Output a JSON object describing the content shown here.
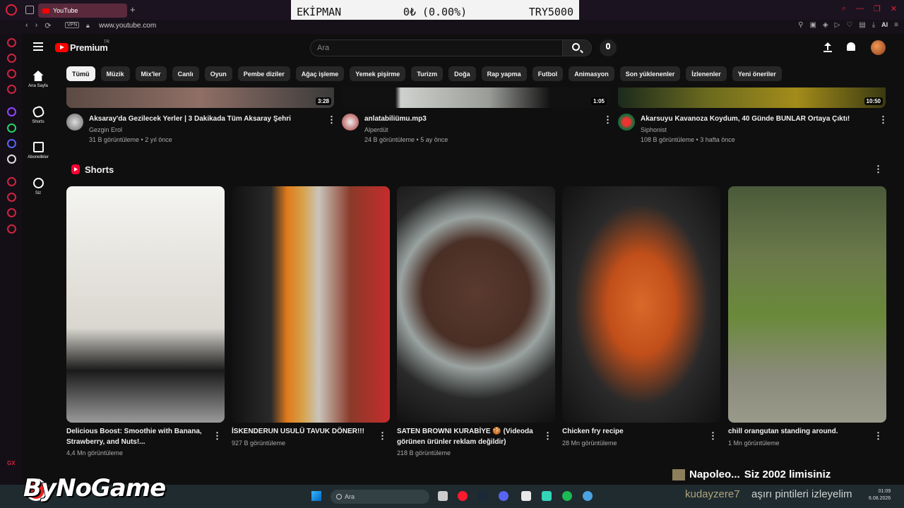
{
  "browser": {
    "tab_title": "YouTube",
    "tab_add": "+",
    "url": "www.youtube.com",
    "vpn_label": "VPN",
    "ai_label": "AI",
    "nav": [
      "‹",
      "›",
      "⟳"
    ],
    "window_controls": [
      "⌕",
      "—",
      "❐",
      "✕"
    ],
    "gx_label": "GX"
  },
  "overlay_stats": {
    "name": "EKİPMAN",
    "value": "0₺ (0.00%)",
    "total": "TRY5000"
  },
  "youtube": {
    "brand": "Premium",
    "region": "TR",
    "search_placeholder": "Ara",
    "left_nav": [
      {
        "label": "Ana Sayfa",
        "icon": "home-icon"
      },
      {
        "label": "Shorts",
        "icon": "shorts-icon"
      },
      {
        "label": "Abonelikler",
        "icon": "subscriptions-icon"
      },
      {
        "label": "Siz",
        "icon": "you-icon"
      }
    ],
    "chips": [
      "Tümü",
      "Müzik",
      "Mix'ler",
      "Canlı",
      "Oyun",
      "Pembe diziler",
      "Ağaç işleme",
      "Yemek pişirme",
      "Turizm",
      "Doğa",
      "Rap yapma",
      "Futbol",
      "Animasyon",
      "Son yüklenenler",
      "İzlenenler",
      "Yeni öneriler"
    ],
    "active_chip": "Tümü",
    "videos": [
      {
        "title": "Aksaray'da Gezilecek Yerler | 3 Dakikada Tüm Aksaray Şehri",
        "channel": "Gezgin Erol",
        "meta": "31 B görüntüleme • 2 yıl önce",
        "duration": "3:28"
      },
      {
        "title": "anlatabiliümu.mp3",
        "channel": "Alperdüt",
        "meta": "24 B görüntüleme • 5 ay önce",
        "duration": "1:05"
      },
      {
        "title": "Akarsuyu Kavanoza Koydum, 40 Günde BUNLAR Ortaya Çıktı!",
        "channel": "Siphonist",
        "meta": "108 B görüntüleme • 3 hafta önce",
        "duration": "10:50"
      }
    ],
    "shorts_heading": "Shorts",
    "shorts": [
      {
        "title": "Delicious Boost: Smoothie with Banana, Strawberry, and Nuts!...",
        "views": "4,4 Mn görüntüleme"
      },
      {
        "title": "İSKENDERUN USULÜ TAVUK DÖNER!!!",
        "views": "927 B görüntüleme"
      },
      {
        "title": "SATEN BROWNI KURABİYE 🍪 (Videoda görünen ürünler reklam değildir)",
        "views": "218 B görüntüleme"
      },
      {
        "title": "Chicken fry recipe",
        "views": "28 Mn görüntüleme"
      },
      {
        "title": "chill orangutan standing around.",
        "views": "1 Mn görüntüleme"
      }
    ]
  },
  "stream_overlay": {
    "mini_title": "Napoleo...",
    "mini_text": "Siz 2002 limisiniz",
    "watermark": "ByNoGame",
    "streamer": "kudayzere7",
    "streamer_text": "aşırı pintileri izleyelim"
  },
  "taskbar": {
    "search_placeholder": "Ara",
    "time": "01:09",
    "date": "6.08.2026"
  },
  "colors": {
    "yt_red": "#ff0000",
    "bg": "#0f0f0f",
    "chip_bg": "#272727",
    "opera_red": "#d0243f"
  }
}
